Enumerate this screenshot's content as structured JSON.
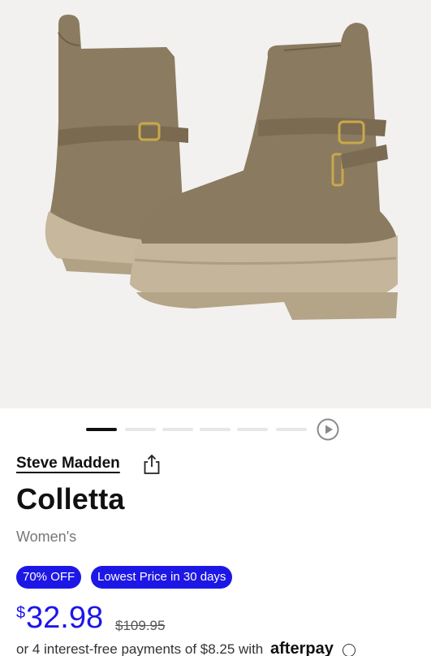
{
  "product": {
    "brand": "Steve Madden",
    "name": "Colletta",
    "gender": "Women's",
    "image_alt": "Taupe suede ankle boots with buckle strap and lug sole",
    "product_color": "#8a7a60",
    "sole_color": "#c5b59b"
  },
  "carousel": {
    "total": 6,
    "active_index": 0
  },
  "badges": {
    "discount": "70% OFF",
    "lowest": "Lowest Price in 30 days"
  },
  "price": {
    "currency": "$",
    "current": "32.98",
    "original": "$109.95",
    "accent_color": "#1d17e6"
  },
  "afterpay": {
    "text": "or 4 interest-free payments of $8.25 with",
    "logo": "afterpay"
  },
  "icons": {
    "share": "share-icon",
    "play": "play-circle-icon",
    "info": "info-icon"
  }
}
